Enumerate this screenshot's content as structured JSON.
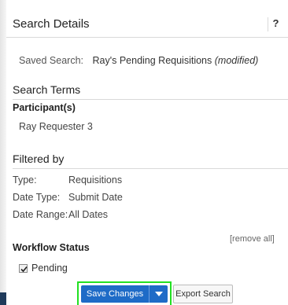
{
  "header": {
    "title": "Search Details",
    "help_label": "?"
  },
  "saved_search": {
    "label": "Saved Search:",
    "name": "Ray's Pending Requisitions",
    "status": "(modified)"
  },
  "search_terms": {
    "title": "Search Terms",
    "participants_label": "Participant(s)",
    "participant": "Ray Requester 3"
  },
  "filtered_by": {
    "title": "Filtered by",
    "rows": [
      {
        "label": "Type:",
        "value": "Requisitions"
      },
      {
        "label": "Date Type:",
        "value": "Submit Date"
      },
      {
        "label": "Date Range:",
        "value": "All Dates"
      }
    ],
    "remove_all": "[remove all]"
  },
  "workflow_status": {
    "title": "Workflow Status",
    "options": [
      {
        "label": "Pending",
        "checked": true
      }
    ]
  },
  "actions": {
    "save_label": "Save Changes",
    "export_label": "Export Search"
  },
  "colors": {
    "primary": "#1e6bc7",
    "highlight": "#22e022"
  }
}
